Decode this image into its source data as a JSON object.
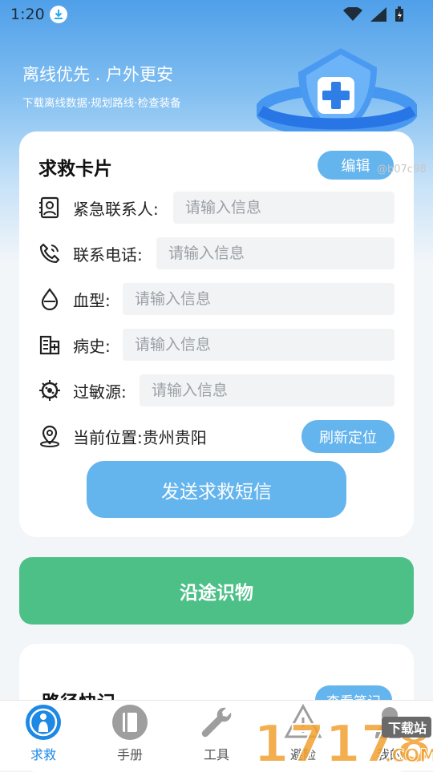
{
  "status_bar": {
    "time": "1:20"
  },
  "hero": {
    "title": "离线优先 . 户外更安",
    "subtitle": "下载离线数据·规划路线·检查装备"
  },
  "rescue_card": {
    "title": "求救卡片",
    "edit_label": "编辑",
    "watermark": "@b07c98",
    "fields": [
      {
        "label": "紧急联系人:",
        "placeholder": "请输入信息",
        "icon": "contact-card-icon"
      },
      {
        "label": "联系电话:",
        "placeholder": "请输入信息",
        "icon": "phone-icon"
      },
      {
        "label": "血型:",
        "placeholder": "请输入信息",
        "icon": "blood-drop-icon"
      },
      {
        "label": "病史:",
        "placeholder": "请输入信息",
        "icon": "hospital-icon"
      },
      {
        "label": "过敏源:",
        "placeholder": "请输入信息",
        "icon": "allergen-icon"
      }
    ],
    "location": {
      "label": "当前位置:",
      "value": "贵州贵阳",
      "refresh_label": "刷新定位"
    },
    "send_label": "发送求救短信"
  },
  "along_button": "沿途识物",
  "notes": {
    "title": "路径快记",
    "view_label": "查看笔记"
  },
  "nav": [
    {
      "label": "求救",
      "icon": "sos-icon",
      "active": true
    },
    {
      "label": "手册",
      "icon": "book-icon",
      "active": false
    },
    {
      "label": "工具",
      "icon": "wrench-icon",
      "active": false
    },
    {
      "label": "避险",
      "icon": "warning-icon",
      "active": false
    },
    {
      "label": "我的",
      "icon": "user-icon",
      "active": false
    }
  ],
  "overlay_logo": {
    "text": "17178",
    "badge": "下载站",
    "domain": ".COM"
  },
  "colors": {
    "primary": "#64b4ee",
    "green": "#4cc087",
    "nav_active": "#1e88e5"
  }
}
